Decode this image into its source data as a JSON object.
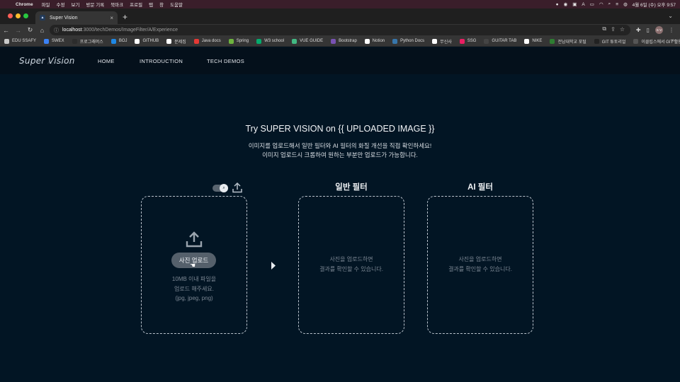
{
  "menubar": {
    "app": "Chrome",
    "items": [
      "파일",
      "수정",
      "보기",
      "방문 기록",
      "북마크",
      "프로필",
      "탭",
      "창",
      "도움말"
    ],
    "clock": "4월 6일 (수) 오후 9:57"
  },
  "browser": {
    "tab_title": "Super Vision",
    "url_host": "localhost",
    "url_path": ":3000/techDemos/ImageFilter/A/Experience",
    "profile": "S·V"
  },
  "bookmarks": [
    {
      "label": "EDU SSAFY",
      "color": "#c9c9c9"
    },
    {
      "label": "SWEX",
      "color": "#3b82f6"
    },
    {
      "label": "프로그래머스",
      "color": "#2c2c2c"
    },
    {
      "label": "BOJ",
      "color": "#1e88e5"
    },
    {
      "label": "GITHUB",
      "color": "#ffffff"
    },
    {
      "label": "문제집",
      "color": "#ffffff"
    },
    {
      "label": "Java docs",
      "color": "#e53935"
    },
    {
      "label": "Spring",
      "color": "#6db33f"
    },
    {
      "label": "W3 school",
      "color": "#04aa6d"
    },
    {
      "label": "VUE GUIDE",
      "color": "#42b883"
    },
    {
      "label": "Bootstrap",
      "color": "#7952b3"
    },
    {
      "label": "Notion",
      "color": "#ffffff"
    },
    {
      "label": "Python Docs",
      "color": "#3776ab"
    },
    {
      "label": "무신사",
      "color": "#ffffff"
    },
    {
      "label": "SSG",
      "color": "#e91e63"
    },
    {
      "label": "GUITAR TAB",
      "color": "#444444"
    },
    {
      "label": "NIKE",
      "color": "#ffffff"
    },
    {
      "label": "전남대학교 포털",
      "color": "#2e7d32"
    },
    {
      "label": "GIT 튜토리얼",
      "color": "#222222"
    },
    {
      "label": "이클립스에서 GIT 활용",
      "color": "#555555"
    }
  ],
  "site": {
    "logo": "Super Vision",
    "nav": [
      "HOME",
      "INTRODUCTION",
      "TECH DEMOS"
    ]
  },
  "main": {
    "title": "Try SUPER VISION on {{ UPLOADED IMAGE }}",
    "desc_line1": "이미지를 업로드해서 일반 필터와 AI 필터의 화질 개선을 직접 확인하세요!",
    "desc_line2": "이미지 업로드시 크롭하여 원하는 부분만 업로드가 가능합니다.",
    "upload_button": "사진 업로드",
    "hint_line1": "10MB 이내 파일을",
    "hint_line2": "업로드 해주세요.",
    "hint_line3": "(jpg, jpeg, png)",
    "normal_filter_title": "일반 필터",
    "ai_filter_title": "AI 필터",
    "placeholder_line1": "사진을 업로드하면",
    "placeholder_line2": "결과를 확인할 수 있습니다."
  },
  "colors": {
    "page_bg": "#021524",
    "header_bg": "#04101b",
    "button_bg": "#55606b"
  }
}
